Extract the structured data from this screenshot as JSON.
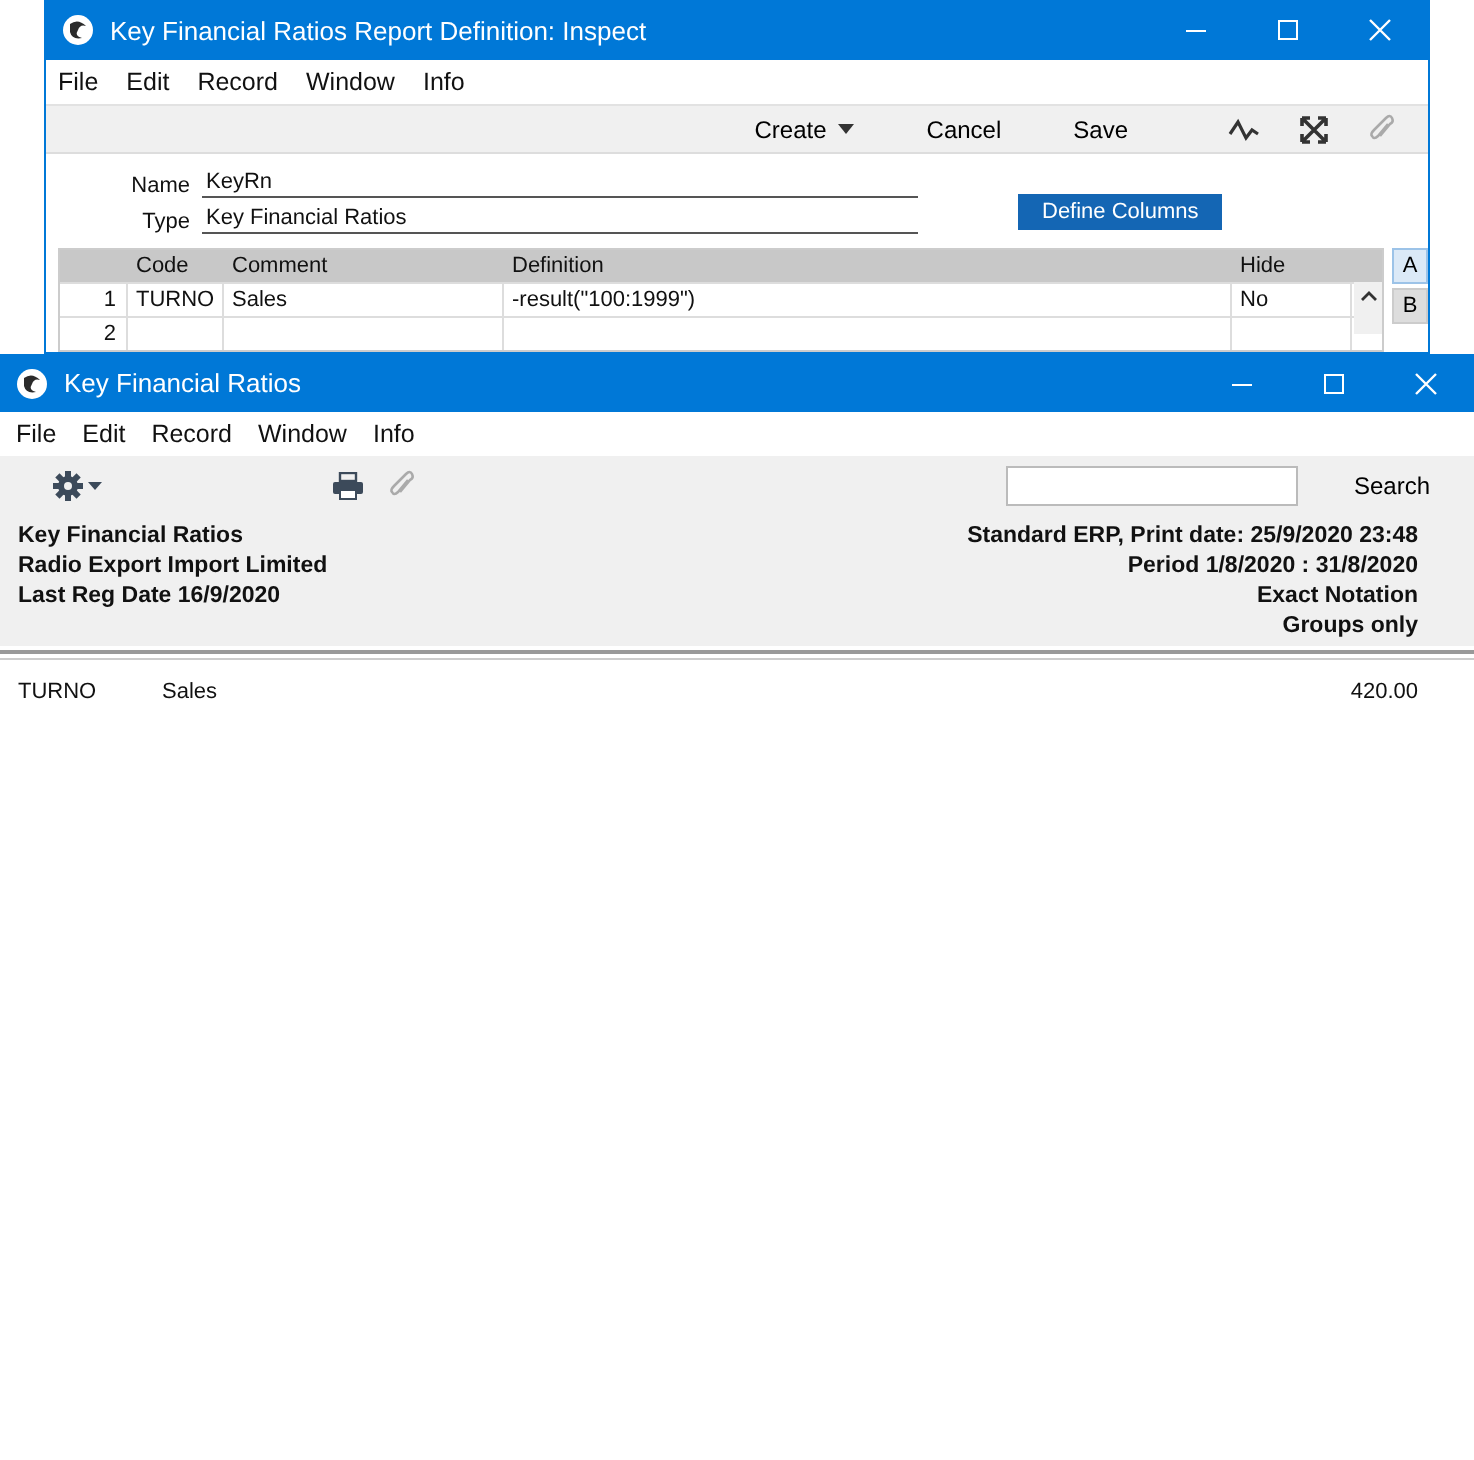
{
  "back_window": {
    "title": "Key Financial Ratios Report Definition: Inspect",
    "menu": [
      "File",
      "Edit",
      "Record",
      "Window",
      "Info"
    ],
    "toolbar": [
      {
        "label": "Create",
        "kind": "dropdown"
      },
      {
        "label": "Cancel",
        "kind": "plain"
      },
      {
        "label": "Save",
        "kind": "plain"
      }
    ],
    "fields": [
      {
        "label": "Name",
        "value": "KeyRn"
      },
      {
        "label": "Type",
        "value": "Key Financial Ratios"
      }
    ],
    "define_button": "Define Columns",
    "table": {
      "columns": [
        "Code",
        "Comment",
        "Definition",
        "Hide"
      ],
      "rows": [
        {
          "number": "1",
          "cells": [
            "TURNO",
            "Sales",
            "-result(\"100:1999\")",
            "No"
          ]
        },
        {
          "number": "2",
          "cells": [
            "",
            "",
            "",
            ""
          ]
        }
      ]
    },
    "side_tabs": [
      {
        "label": "A",
        "selected": true
      },
      {
        "label": "B",
        "selected": false
      }
    ]
  },
  "front_window": {
    "title": "Key Financial Ratios",
    "menu": [
      "File",
      "Edit",
      "Record",
      "Window",
      "Info"
    ],
    "search_button": "Search",
    "header_left": [
      "Key Financial Ratios",
      "Radio Export Import Limited",
      "Last Reg Date  16/9/2020"
    ],
    "header_right": [
      "Standard ERP, Print date: 25/9/2020 23:48",
      "Period  1/8/2020 : 31/8/2020",
      "Exact Notation",
      "Groups only"
    ],
    "rows": [
      {
        "code": "TURNO",
        "comment": "Sales",
        "value": "420.00"
      }
    ]
  }
}
